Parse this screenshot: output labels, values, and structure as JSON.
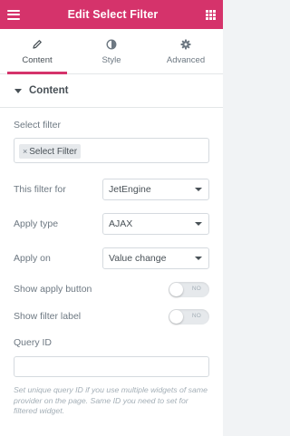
{
  "header": {
    "title": "Edit Select Filter",
    "menu_icon": "hamburger-icon",
    "widgets_icon": "grid-icon"
  },
  "tabs": [
    {
      "label": "Content",
      "icon": "pencil-icon",
      "active": true
    },
    {
      "label": "Style",
      "icon": "half-circle-icon",
      "active": false
    },
    {
      "label": "Advanced",
      "icon": "gear-icon",
      "active": false
    }
  ],
  "section": {
    "title": "Content",
    "expanded": true
  },
  "select_filter": {
    "label": "Select filter",
    "tag": "Select Filter",
    "remove_glyph": "×"
  },
  "this_filter_for": {
    "label": "This filter for",
    "value": "JetEngine"
  },
  "apply_type": {
    "label": "Apply type",
    "value": "AJAX"
  },
  "apply_on": {
    "label": "Apply on",
    "value": "Value change"
  },
  "show_apply_button": {
    "label": "Show apply button",
    "state": "NO"
  },
  "show_filter_label": {
    "label": "Show filter label",
    "state": "NO"
  },
  "query_id": {
    "label": "Query ID",
    "value": "",
    "note": "Set unique query ID if you use multiple widgets of same provider on the page. Same ID you need to set for filtered widget."
  },
  "colors": {
    "accent": "#d5336b"
  }
}
